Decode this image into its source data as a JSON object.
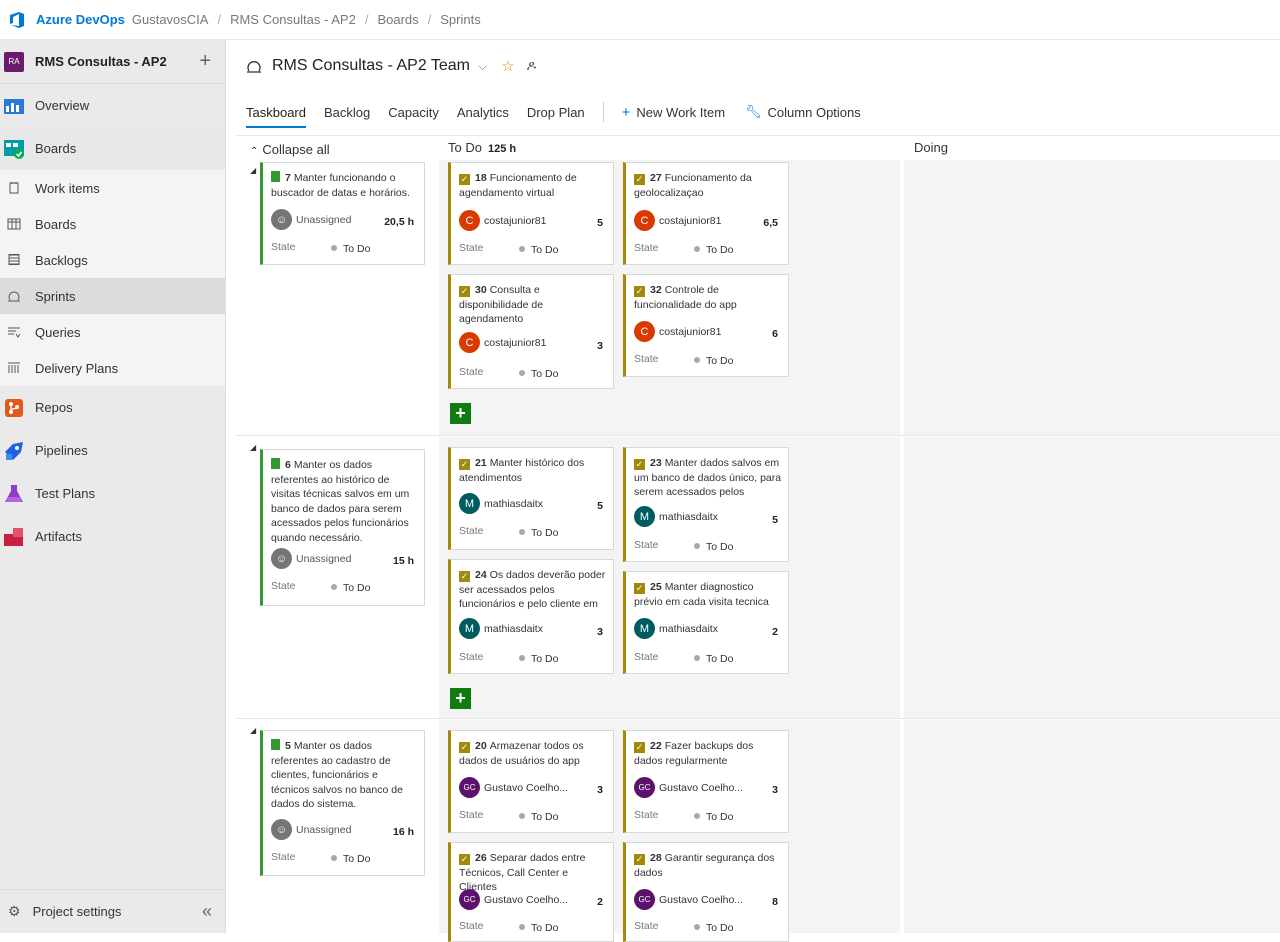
{
  "topbar": {
    "brand": "Azure DevOps",
    "org": "GustavosCIA",
    "project": "RMS Consultas - AP2",
    "section": "Boards",
    "page": "Sprints"
  },
  "sidebar": {
    "project_initials": "RA",
    "project_name": "RMS Consultas - AP2",
    "add": "+",
    "items": [
      {
        "label": "Overview",
        "icon": "overview-icon"
      },
      {
        "label": "Boards",
        "icon": "boards-icon"
      },
      {
        "label": "Work items",
        "icon": "work-items-icon"
      },
      {
        "label": "Boards",
        "icon": "boards-sub-icon"
      },
      {
        "label": "Backlogs",
        "icon": "backlogs-icon"
      },
      {
        "label": "Sprints",
        "icon": "sprints-icon"
      },
      {
        "label": "Queries",
        "icon": "queries-icon"
      },
      {
        "label": "Delivery Plans",
        "icon": "delivery-plans-icon"
      },
      {
        "label": "Repos",
        "icon": "repos-icon"
      },
      {
        "label": "Pipelines",
        "icon": "pipelines-icon"
      },
      {
        "label": "Test Plans",
        "icon": "test-plans-icon"
      },
      {
        "label": "Artifacts",
        "icon": "artifacts-icon"
      }
    ],
    "settings": "Project settings",
    "collapse": "«"
  },
  "header": {
    "team": "RMS Consultas - AP2 Team",
    "chevron": "⌵",
    "star": "☆",
    "people": "ዶ"
  },
  "tabs": [
    "Taskboard",
    "Backlog",
    "Capacity",
    "Analytics",
    "Drop Plan"
  ],
  "toolbar": {
    "new_item": "New Work Item",
    "column_options": "Column Options"
  },
  "board": {
    "collapse_all": "Collapse all",
    "todo_label": "To Do",
    "todo_hours": "125 h",
    "doing_label": "Doing",
    "state_label": "State",
    "state_value": "To Do",
    "lanes": [
      {
        "story": {
          "id": "7",
          "title": "Manter funcionando o buscador de datas e horários.",
          "assignee": "Unassigned",
          "est": "20,5 h"
        },
        "tasks": [
          {
            "id": "18",
            "title": "Funcionamento de agendamento virtual",
            "assignee": "costajunior81",
            "est": "5",
            "initials": "C"
          },
          {
            "id": "27",
            "title": "Funcionamento da geolocalizaçao",
            "assignee": "costajunior81",
            "est": "6,5",
            "initials": "C"
          },
          {
            "id": "30",
            "title": "Consulta e disponibilidade de agendamento",
            "assignee": "costajunior81",
            "est": "3",
            "initials": "C"
          },
          {
            "id": "32",
            "title": "Controle de funcionalidade do app",
            "assignee": "costajunior81",
            "est": "6",
            "initials": "C"
          }
        ]
      },
      {
        "story": {
          "id": "6",
          "title": "Manter os dados referentes ao histórico de visitas técnicas salvos em um banco de dados para serem acessados pelos funcionários quando necessário.",
          "assignee": "Unassigned",
          "est": "15 h"
        },
        "tasks": [
          {
            "id": "21",
            "title": "Manter histórico dos atendimentos",
            "assignee": "mathiasdaitx",
            "est": "5",
            "initials": "M"
          },
          {
            "id": "23",
            "title": "Manter dados salvos em um banco de dados único, para serem acessados pelos",
            "assignee": "mathiasdaitx",
            "est": "5",
            "initials": "M"
          },
          {
            "id": "24",
            "title": "Os dados deverão poder ser acessados pelos funcionários e pelo cliente em",
            "assignee": "mathiasdaitx",
            "est": "3",
            "initials": "M"
          },
          {
            "id": "25",
            "title": "Manter diagnostico prévio em cada visita tecnica",
            "assignee": "mathiasdaitx",
            "est": "2",
            "initials": "M"
          }
        ]
      },
      {
        "story": {
          "id": "5",
          "title": "Manter os dados referentes ao cadastro de clientes, funcionários e técnicos salvos no banco de dados do sistema.",
          "assignee": "Unassigned",
          "est": "16 h"
        },
        "tasks": [
          {
            "id": "20",
            "title": "Armazenar todos os dados de usuários do app",
            "assignee": "Gustavo Coelho...",
            "est": "3",
            "initials": "GC"
          },
          {
            "id": "22",
            "title": "Fazer backups dos dados regularmente",
            "assignee": "Gustavo Coelho...",
            "est": "3",
            "initials": "GC"
          },
          {
            "id": "26",
            "title": "Separar dados entre Técnicos, Call Center e Clientes",
            "assignee": "Gustavo Coelho...",
            "est": "2",
            "initials": "GC"
          },
          {
            "id": "28",
            "title": "Garantir segurança dos dados",
            "assignee": "Gustavo Coelho...",
            "est": "8",
            "initials": "GC"
          }
        ]
      }
    ]
  },
  "colors": {
    "accent": "#0078d4",
    "story": "#339933",
    "task": "#a4880a",
    "add": "#107c10"
  }
}
